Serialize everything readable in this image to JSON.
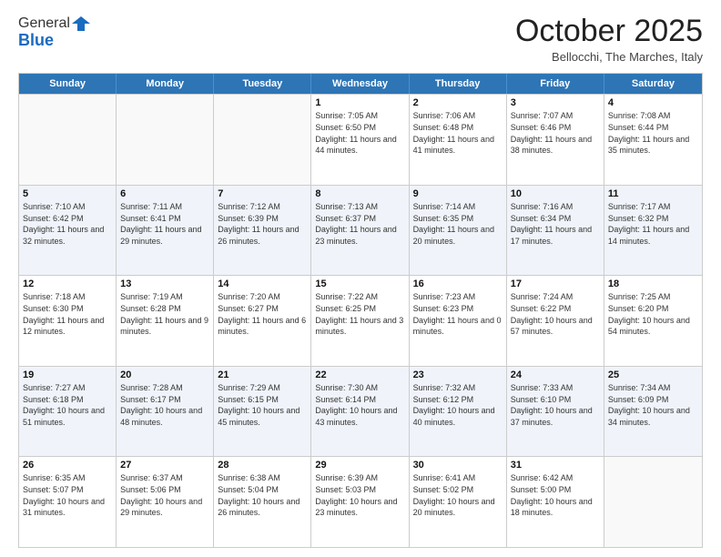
{
  "header": {
    "logo_line1": "General",
    "logo_line2": "Blue",
    "month": "October 2025",
    "location": "Bellocchi, The Marches, Italy"
  },
  "weekdays": [
    "Sunday",
    "Monday",
    "Tuesday",
    "Wednesday",
    "Thursday",
    "Friday",
    "Saturday"
  ],
  "rows": [
    [
      {
        "day": "",
        "info": ""
      },
      {
        "day": "",
        "info": ""
      },
      {
        "day": "",
        "info": ""
      },
      {
        "day": "1",
        "info": "Sunrise: 7:05 AM\nSunset: 6:50 PM\nDaylight: 11 hours and 44 minutes."
      },
      {
        "day": "2",
        "info": "Sunrise: 7:06 AM\nSunset: 6:48 PM\nDaylight: 11 hours and 41 minutes."
      },
      {
        "day": "3",
        "info": "Sunrise: 7:07 AM\nSunset: 6:46 PM\nDaylight: 11 hours and 38 minutes."
      },
      {
        "day": "4",
        "info": "Sunrise: 7:08 AM\nSunset: 6:44 PM\nDaylight: 11 hours and 35 minutes."
      }
    ],
    [
      {
        "day": "5",
        "info": "Sunrise: 7:10 AM\nSunset: 6:42 PM\nDaylight: 11 hours and 32 minutes."
      },
      {
        "day": "6",
        "info": "Sunrise: 7:11 AM\nSunset: 6:41 PM\nDaylight: 11 hours and 29 minutes."
      },
      {
        "day": "7",
        "info": "Sunrise: 7:12 AM\nSunset: 6:39 PM\nDaylight: 11 hours and 26 minutes."
      },
      {
        "day": "8",
        "info": "Sunrise: 7:13 AM\nSunset: 6:37 PM\nDaylight: 11 hours and 23 minutes."
      },
      {
        "day": "9",
        "info": "Sunrise: 7:14 AM\nSunset: 6:35 PM\nDaylight: 11 hours and 20 minutes."
      },
      {
        "day": "10",
        "info": "Sunrise: 7:16 AM\nSunset: 6:34 PM\nDaylight: 11 hours and 17 minutes."
      },
      {
        "day": "11",
        "info": "Sunrise: 7:17 AM\nSunset: 6:32 PM\nDaylight: 11 hours and 14 minutes."
      }
    ],
    [
      {
        "day": "12",
        "info": "Sunrise: 7:18 AM\nSunset: 6:30 PM\nDaylight: 11 hours and 12 minutes."
      },
      {
        "day": "13",
        "info": "Sunrise: 7:19 AM\nSunset: 6:28 PM\nDaylight: 11 hours and 9 minutes."
      },
      {
        "day": "14",
        "info": "Sunrise: 7:20 AM\nSunset: 6:27 PM\nDaylight: 11 hours and 6 minutes."
      },
      {
        "day": "15",
        "info": "Sunrise: 7:22 AM\nSunset: 6:25 PM\nDaylight: 11 hours and 3 minutes."
      },
      {
        "day": "16",
        "info": "Sunrise: 7:23 AM\nSunset: 6:23 PM\nDaylight: 11 hours and 0 minutes."
      },
      {
        "day": "17",
        "info": "Sunrise: 7:24 AM\nSunset: 6:22 PM\nDaylight: 10 hours and 57 minutes."
      },
      {
        "day": "18",
        "info": "Sunrise: 7:25 AM\nSunset: 6:20 PM\nDaylight: 10 hours and 54 minutes."
      }
    ],
    [
      {
        "day": "19",
        "info": "Sunrise: 7:27 AM\nSunset: 6:18 PM\nDaylight: 10 hours and 51 minutes."
      },
      {
        "day": "20",
        "info": "Sunrise: 7:28 AM\nSunset: 6:17 PM\nDaylight: 10 hours and 48 minutes."
      },
      {
        "day": "21",
        "info": "Sunrise: 7:29 AM\nSunset: 6:15 PM\nDaylight: 10 hours and 45 minutes."
      },
      {
        "day": "22",
        "info": "Sunrise: 7:30 AM\nSunset: 6:14 PM\nDaylight: 10 hours and 43 minutes."
      },
      {
        "day": "23",
        "info": "Sunrise: 7:32 AM\nSunset: 6:12 PM\nDaylight: 10 hours and 40 minutes."
      },
      {
        "day": "24",
        "info": "Sunrise: 7:33 AM\nSunset: 6:10 PM\nDaylight: 10 hours and 37 minutes."
      },
      {
        "day": "25",
        "info": "Sunrise: 7:34 AM\nSunset: 6:09 PM\nDaylight: 10 hours and 34 minutes."
      }
    ],
    [
      {
        "day": "26",
        "info": "Sunrise: 6:35 AM\nSunset: 5:07 PM\nDaylight: 10 hours and 31 minutes."
      },
      {
        "day": "27",
        "info": "Sunrise: 6:37 AM\nSunset: 5:06 PM\nDaylight: 10 hours and 29 minutes."
      },
      {
        "day": "28",
        "info": "Sunrise: 6:38 AM\nSunset: 5:04 PM\nDaylight: 10 hours and 26 minutes."
      },
      {
        "day": "29",
        "info": "Sunrise: 6:39 AM\nSunset: 5:03 PM\nDaylight: 10 hours and 23 minutes."
      },
      {
        "day": "30",
        "info": "Sunrise: 6:41 AM\nSunset: 5:02 PM\nDaylight: 10 hours and 20 minutes."
      },
      {
        "day": "31",
        "info": "Sunrise: 6:42 AM\nSunset: 5:00 PM\nDaylight: 10 hours and 18 minutes."
      },
      {
        "day": "",
        "info": ""
      }
    ]
  ]
}
